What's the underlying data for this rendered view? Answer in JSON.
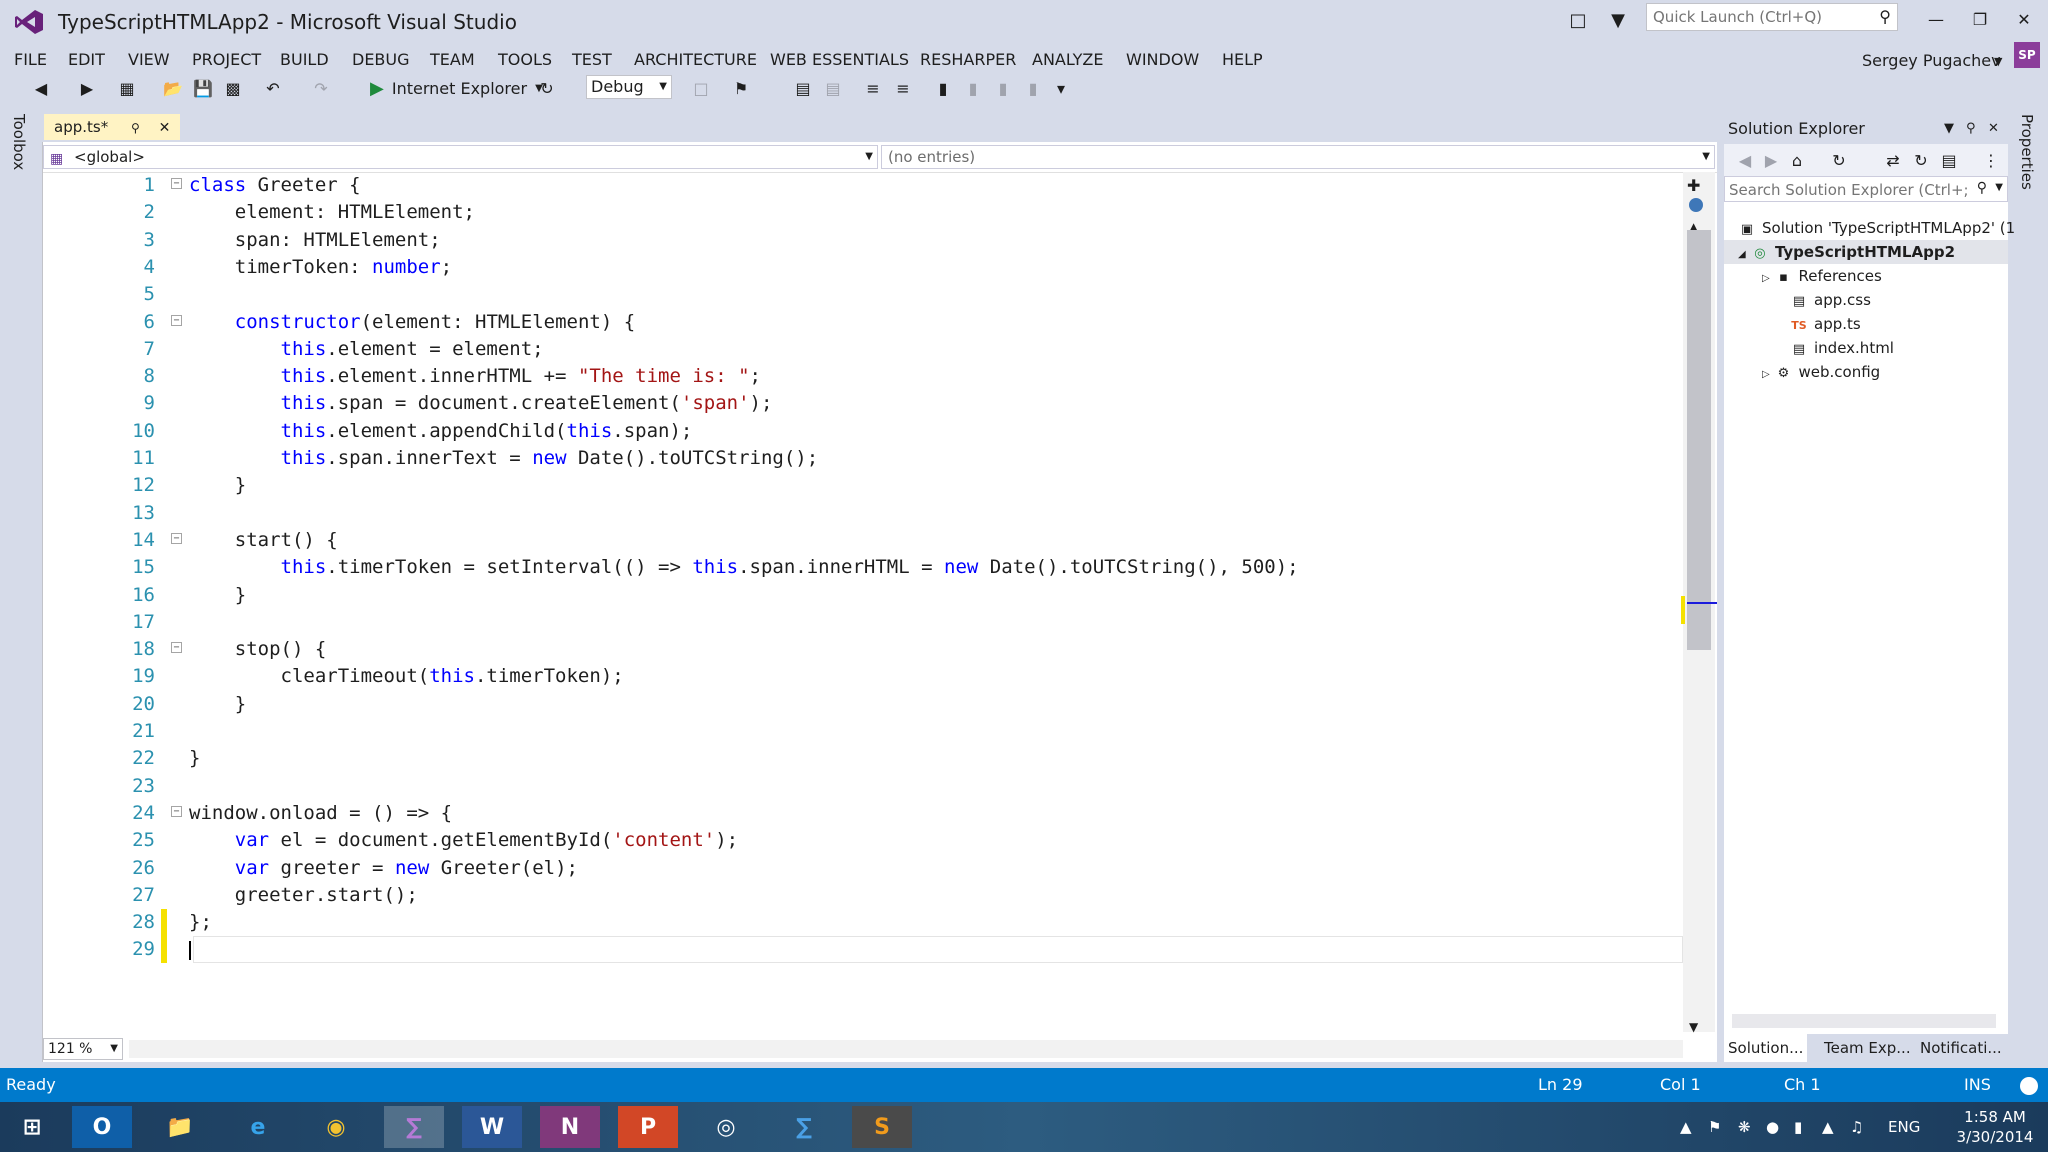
{
  "window": {
    "title": "TypeScriptHTMLApp2 - Microsoft Visual Studio",
    "quick_launch_placeholder": "Quick Launch (Ctrl+Q)"
  },
  "menu": {
    "items": [
      "FILE",
      "EDIT",
      "VIEW",
      "PROJECT",
      "BUILD",
      "DEBUG",
      "TEAM",
      "TOOLS",
      "TEST",
      "ARCHITECTURE",
      "WEB ESSENTIALS",
      "RESHARPER",
      "ANALYZE",
      "WINDOW",
      "HELP"
    ],
    "user": "Sergey Pugachev",
    "avatar": "SP"
  },
  "toolbar": {
    "browser": "Internet Explorer",
    "config": "Debug"
  },
  "side_tabs": {
    "left": "Toolbox",
    "right": "Properties"
  },
  "editor": {
    "tab_label": "app.ts*",
    "nav_scope": "<global>",
    "nav_members": "(no entries)",
    "zoom": "121 %",
    "lines": [
      {
        "n": "1",
        "text": "class Greeter {"
      },
      {
        "n": "2",
        "text": "    element: HTMLElement;"
      },
      {
        "n": "3",
        "text": "    span: HTMLElement;"
      },
      {
        "n": "4",
        "text": "    timerToken: number;"
      },
      {
        "n": "5",
        "text": ""
      },
      {
        "n": "6",
        "text": "    constructor(element: HTMLElement) {"
      },
      {
        "n": "7",
        "text": "        this.element = element;"
      },
      {
        "n": "8",
        "text": "        this.element.innerHTML += \"The time is: \";"
      },
      {
        "n": "9",
        "text": "        this.span = document.createElement('span');"
      },
      {
        "n": "10",
        "text": "        this.element.appendChild(this.span);"
      },
      {
        "n": "11",
        "text": "        this.span.innerText = new Date().toUTCString();"
      },
      {
        "n": "12",
        "text": "    }"
      },
      {
        "n": "13",
        "text": ""
      },
      {
        "n": "14",
        "text": "    start() {"
      },
      {
        "n": "15",
        "text": "        this.timerToken = setInterval(() => this.span.innerHTML = new Date().toUTCString(), 500);"
      },
      {
        "n": "16",
        "text": "    }"
      },
      {
        "n": "17",
        "text": ""
      },
      {
        "n": "18",
        "text": "    stop() {"
      },
      {
        "n": "19",
        "text": "        clearTimeout(this.timerToken);"
      },
      {
        "n": "20",
        "text": "    }"
      },
      {
        "n": "21",
        "text": ""
      },
      {
        "n": "22",
        "text": "}"
      },
      {
        "n": "23",
        "text": ""
      },
      {
        "n": "24",
        "text": "window.onload = () => {"
      },
      {
        "n": "25",
        "text": "    var el = document.getElementById('content');"
      },
      {
        "n": "26",
        "text": "    var greeter = new Greeter(el);"
      },
      {
        "n": "27",
        "text": "    greeter.start();"
      },
      {
        "n": "28",
        "text": "};"
      },
      {
        "n": "29",
        "text": ""
      }
    ]
  },
  "solution_explorer": {
    "title": "Solution Explorer",
    "search_placeholder": "Search Solution Explorer (Ctrl+;)",
    "solution": "Solution 'TypeScriptHTMLApp2' (1",
    "project": "TypeScriptHTMLApp2",
    "items": [
      "References",
      "app.css",
      "app.ts",
      "index.html",
      "web.config"
    ],
    "tabs": [
      "Solution...",
      "Team Exp...",
      "Notificati..."
    ]
  },
  "status": {
    "state": "Ready",
    "ln": "Ln 29",
    "col": "Col 1",
    "ch": "Ch 1",
    "ins": "INS"
  },
  "taskbar": {
    "lang": "ENG",
    "time": "1:58 AM",
    "date": "3/30/2014"
  }
}
